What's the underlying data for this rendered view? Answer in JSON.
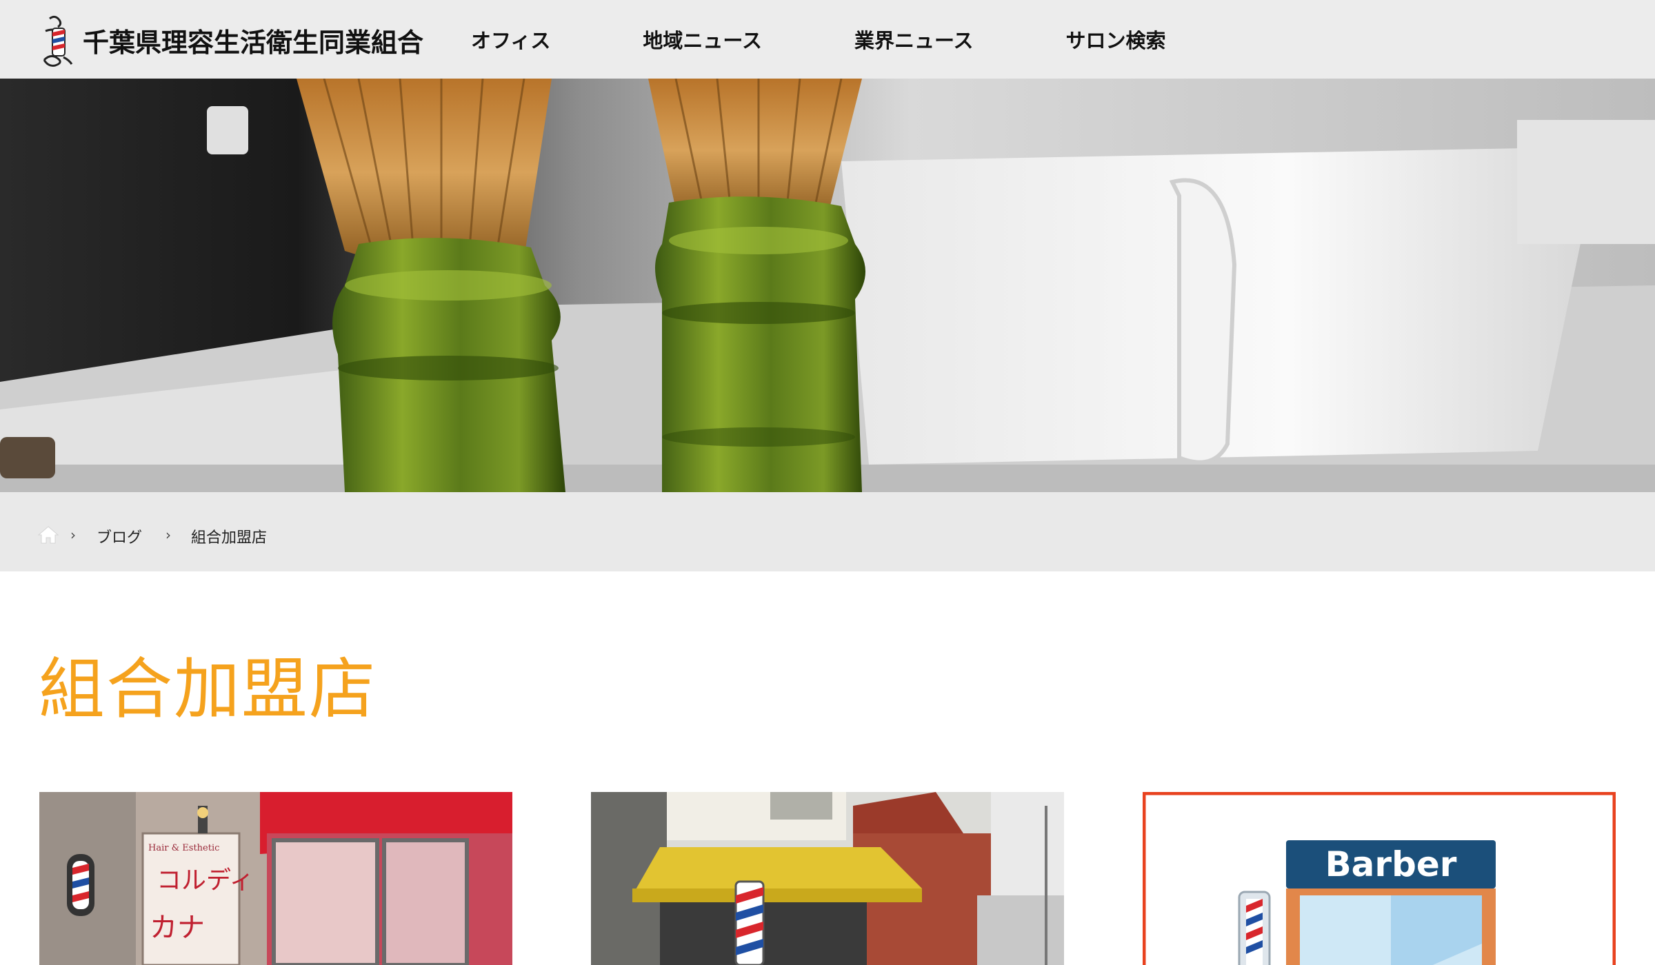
{
  "site": {
    "logo_text": "千葉県理容生活衛生同業組合"
  },
  "nav": {
    "items": [
      {
        "label": "オフィス"
      },
      {
        "label": "地域ニュース"
      },
      {
        "label": "業界ニュース"
      },
      {
        "label": "サロン検索"
      }
    ]
  },
  "breadcrumb": {
    "home_icon": "home-icon",
    "items": [
      {
        "label": "ブログ"
      },
      {
        "label": "組合加盟店"
      }
    ],
    "separator": "›"
  },
  "page": {
    "title": "組合加盟店"
  },
  "cards": [
    {
      "sign_small": "Hair & Esthetic",
      "sign_large": "コルディ",
      "sign_line2": "カナ"
    },
    {
      "sign_text": ""
    },
    {
      "sign_text": "Barber"
    }
  ],
  "colors": {
    "header_bg": "#ececec",
    "title_accent": "#f5a21d",
    "card3_border": "#e8421f",
    "barber_sign": "#1b4f7a"
  }
}
